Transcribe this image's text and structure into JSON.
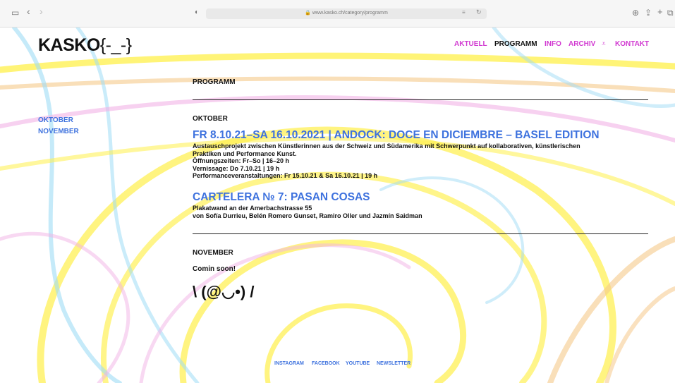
{
  "browser": {
    "url": "www.kasko.ch/category/programm",
    "sidebar_icon": "▭",
    "back_icon": "‹",
    "forward_icon": "›",
    "shield_icon": "◐",
    "lock_icon": "🔒",
    "reader_icon": "≡",
    "reload_icon": "↻",
    "download_icon": "⊕",
    "share_icon": "⇪",
    "newtab_icon": "+",
    "tabs_icon": "⧉"
  },
  "site": {
    "logo_main": "KASKO",
    "logo_tail": "{-_-}",
    "nav": [
      "AKTUELL",
      "PROGRAMM",
      "INFO",
      "ARCHIV",
      "⩡",
      "KONTAKT"
    ]
  },
  "sidebar": {
    "items": [
      "OKTOBER",
      "NOVEMBER"
    ]
  },
  "main": {
    "page_title": "PROGRAMM",
    "oktober": {
      "heading": "OKTOBER",
      "events": [
        {
          "title": "FR 8.10.21–SA 16.10.2021 | ANDOCK: DOCE EN DICIEMBRE – BASEL EDITION",
          "lines": [
            "Austauschprojekt zwischen Künstlerinnen aus der Schweiz und Südamerika mit Schwerpunkt auf kollaborativen, künstlerischen",
            "Praktiken und Performance Kunst.",
            "Öffnungszeiten: Fr–So | 16–20 h",
            "Vernissage: Do 7.10.21 | 19 h",
            "Performanceveranstaltungen: Fr 15.10.21 & Sa 16.10.21 | 19 h"
          ]
        },
        {
          "title": "CARTELERA № 7: PASAN COSAS",
          "lines": [
            "Plakatwand an der Amerbachstrasse 55",
            "von Sofía Durrieu, Belén Romero Gunset, Ramiro Oller und Jazmín Saidman"
          ]
        }
      ]
    },
    "november": {
      "heading": "NOVEMBER",
      "text": "Comin soon!",
      "emoticon": "\\ (@◡•) /"
    }
  },
  "footer": {
    "links": [
      "INSTAGRAM",
      "FACEBOOK",
      "YOUTUBE",
      "NEWSLETTER"
    ]
  },
  "colors": {
    "accent_blue": "#3e72de",
    "nav_magenta": "#d13ad1",
    "wave_yellow": "#fff04a",
    "wave_blue": "#9fdcf5",
    "wave_pink": "#f2b2e6",
    "wave_orange": "#f5c98a"
  }
}
